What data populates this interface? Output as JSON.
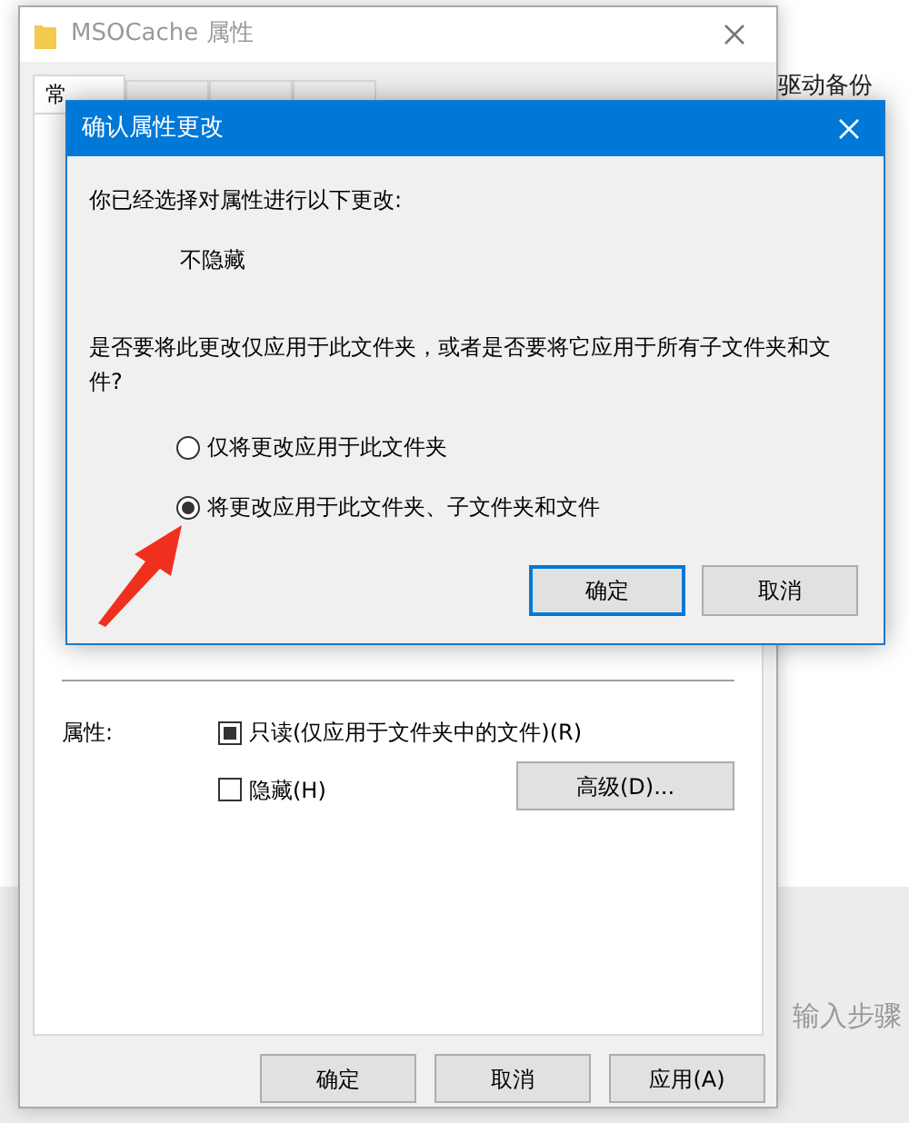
{
  "background": {
    "labels": [
      "驱动备份",
      "输入步骤"
    ]
  },
  "properties_window": {
    "title": "MSOCache 属性",
    "tabs": [
      {
        "label": "常",
        "selected": true
      },
      {
        "selected": false
      },
      {
        "selected": false
      },
      {
        "selected": false
      }
    ],
    "attributes_label": "属性:",
    "attributes": [
      {
        "label": "只读(仅应用于文件夹中的文件)(R)",
        "checked": false,
        "indeterminate": true
      },
      {
        "label": "隐藏(H)",
        "checked": false,
        "indeterminate": false
      }
    ],
    "advanced_button": "高级(D)...",
    "buttons": [
      "确定",
      "取消",
      "应用(A)"
    ]
  },
  "confirm_dialog": {
    "title": "确认属性更改",
    "intro": "你已经选择对属性进行以下更改:",
    "change": "不隐藏",
    "question": "是否要将此更改仅应用于此文件夹，或者是否要将它应用于所有子文件夹和文件?",
    "options": [
      {
        "label": "仅将更改应用于此文件夹",
        "selected": false
      },
      {
        "label": "将更改应用于此文件夹、子文件夹和文件",
        "selected": true
      }
    ],
    "buttons": [
      {
        "label": "确定",
        "default": true
      },
      {
        "label": "取消",
        "default": false
      }
    ]
  }
}
